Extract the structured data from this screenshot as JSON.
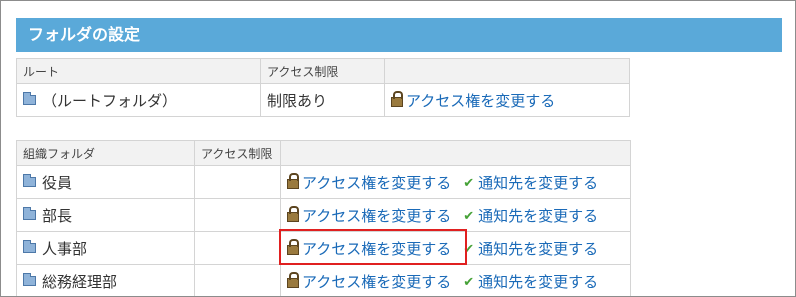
{
  "page": {
    "title": "フォルダの設定"
  },
  "root_table": {
    "headers": [
      "ルート",
      "アクセス制限",
      ""
    ],
    "row": {
      "name": "（ルートフォルダ）",
      "restriction": "制限あり",
      "access_link": "アクセス権を変更する"
    }
  },
  "org_table": {
    "headers": [
      "組織フォルダ",
      "アクセス制限",
      ""
    ],
    "rows": [
      {
        "name": "役員",
        "restriction": "",
        "access_link": "アクセス権を変更する",
        "notify_link": "通知先を変更する"
      },
      {
        "name": "部長",
        "restriction": "",
        "access_link": "アクセス権を変更する",
        "notify_link": "通知先を変更する"
      },
      {
        "name": "人事部",
        "restriction": "",
        "access_link": "アクセス権を変更する",
        "notify_link": "通知先を変更する",
        "highlighted": true
      },
      {
        "name": "総務経理部",
        "restriction": "",
        "access_link": "アクセス権を変更する",
        "notify_link": "通知先を変更する"
      }
    ]
  },
  "colors": {
    "title_bar": "#5aa9d9",
    "link": "#1a6ab8",
    "highlight": "#e02020",
    "check": "#45a136"
  }
}
